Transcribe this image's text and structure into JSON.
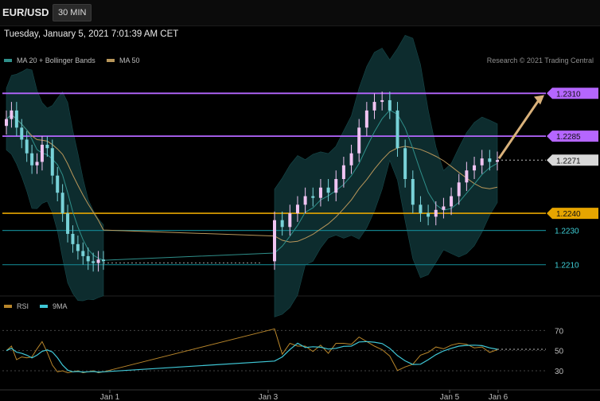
{
  "header": {
    "symbol": "EUR/USD",
    "timeframe": "30 MIN"
  },
  "datetime": "Tuesday, January 5, 2021 7:01:39 AM CET",
  "legend": {
    "ma20_label": "MA 20 + Bollinger Bands",
    "ma50_label": "MA 50",
    "credit": "Research © 2021 Trading Central",
    "rsi_label": "RSI",
    "rsi_ma_label": "9MA"
  },
  "colors": {
    "bg": "#000000",
    "bb_fill": "#0d2c2e",
    "ma20": "#2f8f8a",
    "ma50": "#b8965a",
    "candle_up": "#f0c4f2",
    "candle_down": "#78d2d8",
    "resistance": "#b566ff",
    "pivot": "#e6a500",
    "support": "#137f8a",
    "arrow": "#d9b17a",
    "rsi": "#b8862b",
    "rsi_ma": "#3fc7d6"
  },
  "chart_data": [
    {
      "type": "candlestick",
      "title": "EUR/USD 30 MIN",
      "ylim": [
        1.2195,
        1.2325
      ],
      "x_ticks": [
        "Jan 1",
        "Jan 3",
        "Jan 5",
        "Jan 6"
      ],
      "levels": [
        {
          "value": 1.231,
          "label": "1.2310",
          "kind": "resistance"
        },
        {
          "value": 1.2285,
          "label": "1.2285",
          "kind": "resistance"
        },
        {
          "value": 1.2271,
          "label": "1.2271",
          "kind": "last"
        },
        {
          "value": 1.224,
          "label": "1.2240",
          "kind": "pivot"
        },
        {
          "value": 1.223,
          "label": "1.2230",
          "kind": "support"
        },
        {
          "value": 1.221,
          "label": "1.2210",
          "kind": "support"
        }
      ],
      "close_series": [
        1.2295,
        1.23,
        1.229,
        1.2283,
        1.2275,
        1.2268,
        1.227,
        1.228,
        1.2278,
        1.2262,
        1.2252,
        1.224,
        1.2228,
        1.2222,
        1.2218,
        1.2215,
        1.2212,
        1.2211,
        1.2213,
        1.2212,
        1.2236,
        1.2232,
        1.224,
        1.2245,
        1.225,
        1.2249,
        1.2255,
        1.2252,
        1.226,
        1.2268,
        1.2275,
        1.229,
        1.23,
        1.2305,
        1.2306,
        1.23,
        1.2278,
        1.226,
        1.2245,
        1.224,
        1.2238,
        1.2242,
        1.2244,
        1.225,
        1.2258,
        1.2265,
        1.2268,
        1.2272,
        1.227,
        1.2271
      ],
      "annotations": [
        "projected move toward 1.2310"
      ]
    },
    {
      "type": "line",
      "series": [
        {
          "name": "RSI"
        },
        {
          "name": "9MA"
        }
      ],
      "y_ticks": [
        70,
        50,
        30
      ],
      "ylim": [
        15,
        90
      ]
    }
  ]
}
